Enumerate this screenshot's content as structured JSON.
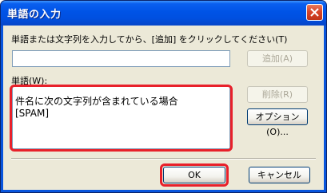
{
  "window": {
    "title": "単語の入力"
  },
  "instruction": "単語または文字列を入力してから、[追加] をクリックしてください(T)",
  "input": {
    "value": ""
  },
  "buttons": {
    "add": "追加(A)",
    "delete": "削除(R)",
    "options": "オプション(O)...",
    "ok": "OK",
    "cancel": "キャンセル"
  },
  "words_label": "単語(W):",
  "words": [
    "件名に次の文字列が含まれている場合",
    "[SPAM]"
  ],
  "colors": {
    "titlebar": "#0054e3",
    "dialog_bg": "#ece9d8",
    "highlight": "#e8202a"
  },
  "icons": {
    "close": "close-icon"
  }
}
